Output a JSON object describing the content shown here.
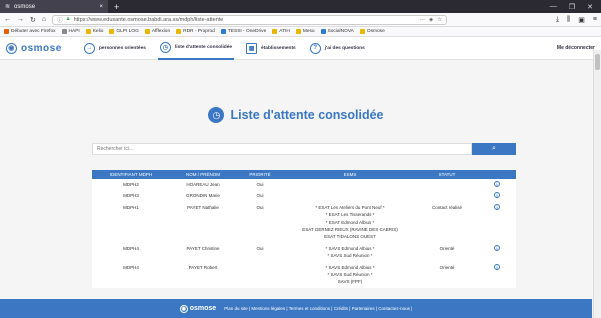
{
  "browser": {
    "tab_title": "osmose",
    "tab_close": "×",
    "new_tab": "+",
    "window_controls": [
      "—",
      "❐",
      "✕"
    ],
    "url": "https://www.edusante.osmose.babdi.ara.ss/mdph/liste-attente",
    "bookmarks": [
      {
        "label": "Débuter avec Firefox",
        "color": "#e66000"
      },
      {
        "label": "HAPI",
        "color": "#888888"
      },
      {
        "label": "Kelio",
        "color": "#e6b800"
      },
      {
        "label": "GLPI LOG",
        "color": "#e6b800"
      },
      {
        "label": "Afflexion",
        "color": "#e6b800"
      },
      {
        "label": "RDR - Proprod",
        "color": "#e6b800"
      },
      {
        "label": "TESSI - OneDrive",
        "color": "#2b7bd6"
      },
      {
        "label": "ATIH",
        "color": "#e6b800"
      },
      {
        "label": "Mesu",
        "color": "#e6b800"
      },
      {
        "label": "SocialNOVA",
        "color": "#2b7bd6"
      },
      {
        "label": "Osmose",
        "color": "#e6b800"
      }
    ]
  },
  "app": {
    "logo": "osmose",
    "nav": [
      {
        "label": "personnes orientées",
        "icon": "arrow-right-icon",
        "glyph": "→"
      },
      {
        "label": "liste d'attente consolidée",
        "icon": "clock-icon",
        "glyph": "◷"
      },
      {
        "label": "établissements",
        "icon": "building-icon",
        "glyph": "▦"
      },
      {
        "label": "j'ai des questions",
        "icon": "question-icon",
        "glyph": "?"
      }
    ],
    "logout": "Me déconnecter"
  },
  "main": {
    "title": "Liste d'attente consolidée",
    "search_placeholder": "Rechercher ici...",
    "columns": [
      "IDENTIFIANT MDPH",
      "NOM / PRÉNOM",
      "PRIORITÉ",
      "ESMS",
      "STATUT"
    ],
    "rows": [
      {
        "id": "MDPH2",
        "name": "HOAREAU Jean",
        "priority": "Oui",
        "esms": [],
        "status": ""
      },
      {
        "id": "MDPH3",
        "name": "GRONDIN Marie",
        "priority": "Oui",
        "esms": [],
        "status": ""
      },
      {
        "id": "MDPH1",
        "name": "PAYET Nathalie",
        "priority": "Oui",
        "esms": [
          "* ESAT Les Ateliers du Pont Neuf *",
          "* ESAT Les Tisserands *",
          "* ESAT Edmond Albius *",
          "ESAT GERNEZ RIEUX (RAVINE DES CABRIS)",
          "ESAT TIDALONS OUEST"
        ],
        "status": "Contact réalisé"
      },
      {
        "id": "MDPH4",
        "name": "PAYET Christine",
        "priority": "Oui",
        "esms": [
          "* SAVS Edmond Albius *",
          "* SAVS Sud Réunion *"
        ],
        "status": "Orienté"
      },
      {
        "id": "MDPH4",
        "name": "PAYET Robert",
        "priority": "",
        "esms": [
          "* SAVS Edmond Albius *",
          "* SAVS Sud Réunion *",
          "SAVS (FPF)"
        ],
        "status": "Orienté"
      }
    ]
  },
  "footer": {
    "logo": "osmose",
    "links": "Plan du site | Mentions légales | Termes et conditions | Crédits | Partenaires | Contactez-nous |"
  },
  "colors": {
    "accent": "#3b77c2"
  }
}
